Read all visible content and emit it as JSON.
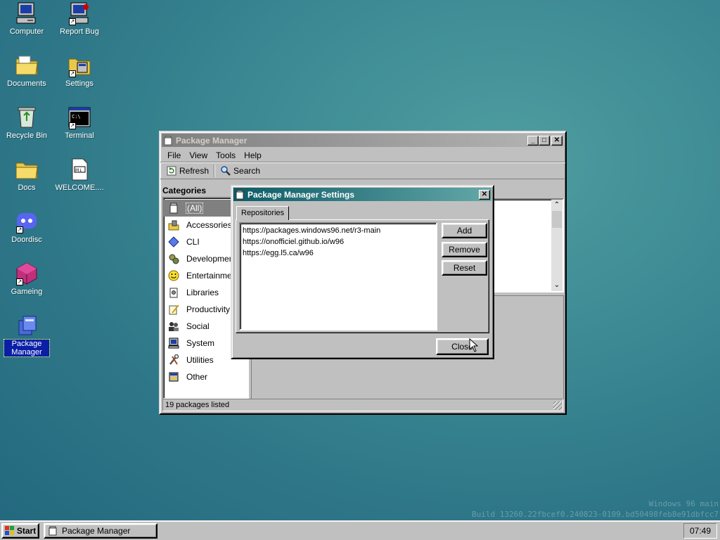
{
  "desktop": {
    "icons": [
      {
        "label": "Computer"
      },
      {
        "label": "Report Bug"
      },
      {
        "label": "Documents"
      },
      {
        "label": "Settings"
      },
      {
        "label": "Recycle Bin"
      },
      {
        "label": "Terminal"
      },
      {
        "label": "Docs"
      },
      {
        "label": "WELCOME...."
      },
      {
        "label": "Doordisc"
      },
      {
        "label": "Gameing"
      },
      {
        "label": "Package Manager"
      }
    ],
    "watermark_line1": "Windows 96 main",
    "watermark_line2": "Build 13260.22fbcef0.240823-0109.bd50498feb8e91dbfcc7"
  },
  "package_manager": {
    "title": "Package Manager",
    "menu": [
      "File",
      "View",
      "Tools",
      "Help"
    ],
    "toolbar": {
      "refresh": "Refresh",
      "search": "Search"
    },
    "categories_heading": "Categories",
    "categories": [
      {
        "label": "(All)",
        "icon": "jar-icon"
      },
      {
        "label": "Accessories",
        "icon": "accessories-icon"
      },
      {
        "label": "CLI",
        "icon": "diamond-icon"
      },
      {
        "label": "Development",
        "icon": "gears-icon"
      },
      {
        "label": "Entertainment",
        "icon": "smiley-icon"
      },
      {
        "label": "Libraries",
        "icon": "library-icon"
      },
      {
        "label": "Productivity",
        "icon": "pencil-paper-icon"
      },
      {
        "label": "Social",
        "icon": "people-icon"
      },
      {
        "label": "System",
        "icon": "monitor-icon"
      },
      {
        "label": "Utilities",
        "icon": "tools-icon"
      },
      {
        "label": "Other",
        "icon": "other-icon"
      }
    ],
    "status": "19 packages listed"
  },
  "settings_dialog": {
    "title": "Package Manager Settings",
    "tab": "Repositories",
    "repositories": [
      "https://packages.windows96.net/r3-main",
      "https://onofficiel.github.io/w96",
      "https://egg.l5.ca/w96"
    ],
    "add": "Add",
    "remove": "Remove",
    "reset": "Reset",
    "close": "Close"
  },
  "taskbar": {
    "start": "Start",
    "task": "Package Manager",
    "clock": "07:49"
  },
  "colors": {
    "selection": "#0a1fa6",
    "active_title_start": "#0d5b66",
    "active_title_end": "#64a8a8"
  }
}
